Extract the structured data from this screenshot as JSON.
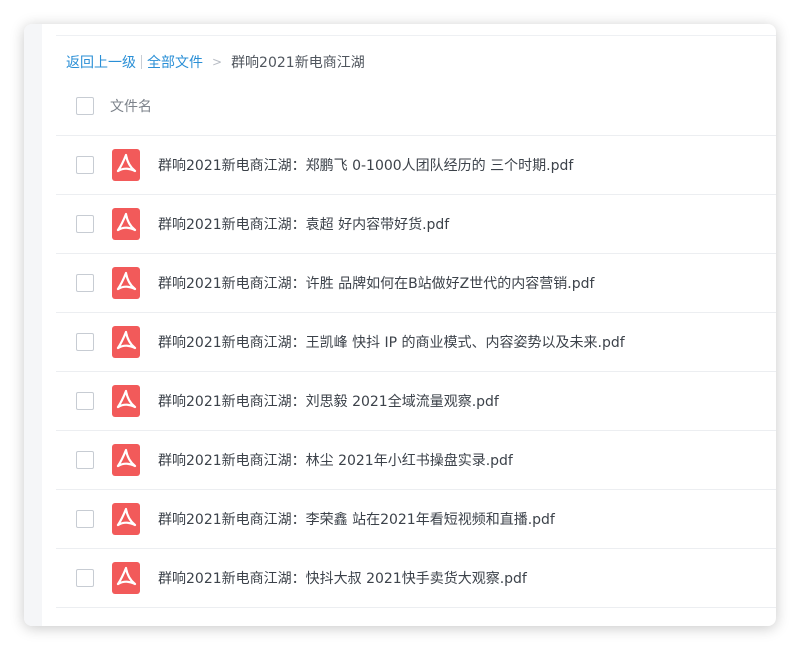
{
  "breadcrumb": {
    "back_label": "返回上一级",
    "all_files_label": "全部文件",
    "arrow": ">",
    "current_folder": "群响2021新电商江湖"
  },
  "list": {
    "header_label": "文件名",
    "files": [
      {
        "name": "群响2021新电商江湖：郑鹏飞 0-1000人团队经历的 三个时期.pdf",
        "icon": "pdf-icon"
      },
      {
        "name": "群响2021新电商江湖：袁超 好内容带好货.pdf",
        "icon": "pdf-icon"
      },
      {
        "name": "群响2021新电商江湖：许胜 品牌如何在B站做好Z世代的内容营销.pdf",
        "icon": "pdf-icon"
      },
      {
        "name": "群响2021新电商江湖：王凯峰 快抖 IP 的商业模式、内容姿势以及未来.pdf",
        "icon": "pdf-icon"
      },
      {
        "name": "群响2021新电商江湖：刘思毅 2021全域流量观察.pdf",
        "icon": "pdf-icon"
      },
      {
        "name": "群响2021新电商江湖：林尘 2021年小红书操盘实录.pdf",
        "icon": "pdf-icon"
      },
      {
        "name": "群响2021新电商江湖：李荣鑫 站在2021年看短视频和直播.pdf",
        "icon": "pdf-icon"
      },
      {
        "name": "群响2021新电商江湖：快抖大叔 2021快手卖货大观察.pdf",
        "icon": "pdf-icon"
      }
    ]
  },
  "colors": {
    "link": "#2a8fd6",
    "pdf_red": "#f25a5a",
    "text": "#3c424a"
  }
}
